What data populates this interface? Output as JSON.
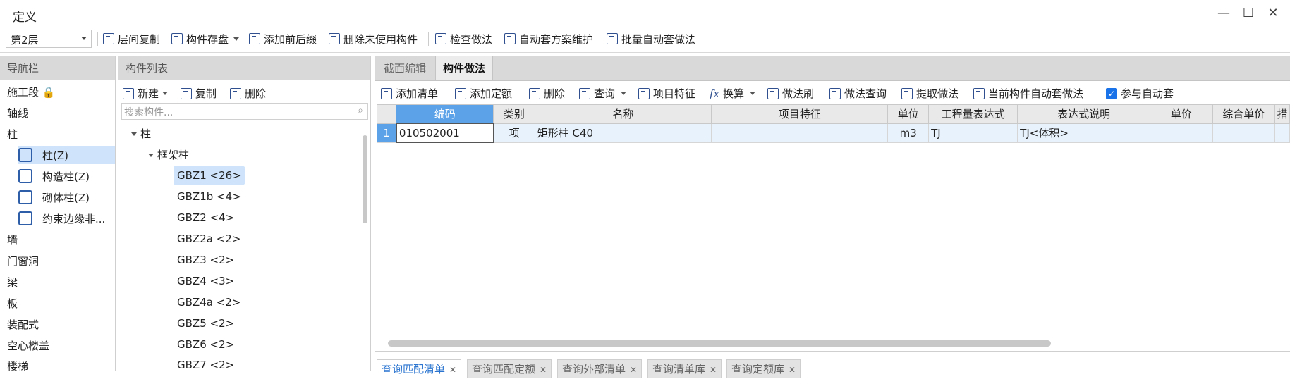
{
  "window": {
    "title": "定义",
    "minimize": "—",
    "maximize": "☐",
    "close": "✕"
  },
  "toolbar": {
    "floor": "第2层",
    "items": [
      "层间复制",
      "构件存盘",
      "添加前后缀",
      "删除未使用构件",
      "检查做法",
      "自动套方案维护",
      "批量自动套做法"
    ]
  },
  "nav": {
    "header": "导航栏",
    "items_top": [
      "施工段",
      "轴线",
      "柱"
    ],
    "sub_items": [
      "柱(Z)",
      "构造柱(Z)",
      "砌体柱(Z)",
      "约束边缘非..."
    ],
    "items_bottom": [
      "墙",
      "门窗洞",
      "梁",
      "板",
      "装配式",
      "空心楼盖",
      "楼梯"
    ]
  },
  "component_list": {
    "header": "构件列表",
    "new": "新建",
    "copy": "复制",
    "delete": "删除",
    "search_placeholder": "搜索构件...",
    "root": "柱",
    "group": "框架柱",
    "leaves": [
      "GBZ1 <26>",
      "GBZ1b <4>",
      "GBZ2 <4>",
      "GBZ2a <2>",
      "GBZ3 <2>",
      "GBZ4 <3>",
      "GBZ4a <2>",
      "GBZ5 <2>",
      "GBZ6 <2>",
      "GBZ7 <2>"
    ]
  },
  "main": {
    "tabs": [
      "截面编辑",
      "构件做法"
    ],
    "toolbar": [
      "添加清单",
      "添加定额",
      "删除",
      "查询",
      "项目特征",
      "换算",
      "做法刷",
      "做法查询",
      "提取做法",
      "当前构件自动套做法",
      "参与自动套"
    ],
    "columns": [
      "编码",
      "类别",
      "名称",
      "项目特征",
      "单位",
      "工程量表达式",
      "表达式说明",
      "单价",
      "综合单价",
      "措"
    ],
    "rows": [
      {
        "no": "1",
        "code": "010502001",
        "type": "项",
        "name": "矩形柱 C40",
        "feature": "",
        "unit": "m3",
        "expr": "TJ",
        "expr_desc": "TJ<体积>",
        "price": "",
        "total_price": "",
        "extra": ""
      }
    ],
    "bottom_tabs": [
      "查询匹配清单",
      "查询匹配定额",
      "查询外部清单",
      "查询清单库",
      "查询定额库"
    ]
  }
}
